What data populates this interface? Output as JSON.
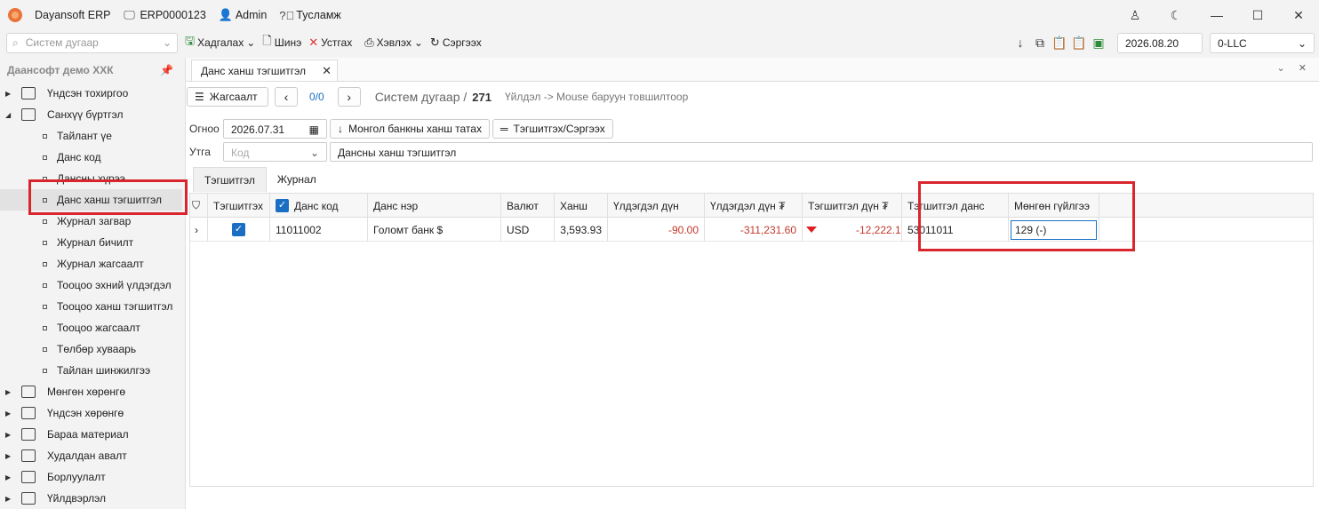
{
  "titlebar": {
    "app_name": "Dayansoft ERP",
    "erp_id": "ERP0000123",
    "user": "Admin",
    "help": "Тусламж"
  },
  "toolbar": {
    "search_placeholder": "Систем дугаар",
    "save": "Хадгалах",
    "new": "Шинэ",
    "delete": "Устгах",
    "print": "Хэвлэх",
    "refresh": "Сэргээх",
    "date": "2026.08.20",
    "company": "0-LLC"
  },
  "sidebar": {
    "header": "Даансофт демо ХХК",
    "items": [
      {
        "label": "Үндсэн тохиргоо",
        "level": 0
      },
      {
        "label": "Санхүү бүртгэл",
        "level": 0
      },
      {
        "label": "Тайлант үе",
        "level": 1
      },
      {
        "label": "Данс код",
        "level": 1
      },
      {
        "label": "Дансны хүрээ",
        "level": 1
      },
      {
        "label": "Данс ханш тэгшитгэл",
        "level": 1
      },
      {
        "label": "Журнал загвар",
        "level": 1
      },
      {
        "label": "Журнал бичилт",
        "level": 1
      },
      {
        "label": "Журнал жагсаалт",
        "level": 1
      },
      {
        "label": "Тооцоо эхний үлдэгдэл",
        "level": 1
      },
      {
        "label": "Тооцоо ханш тэгшитгэл",
        "level": 1
      },
      {
        "label": "Тооцоо жагсаалт",
        "level": 1
      },
      {
        "label": "Төлбөр хуваарь",
        "level": 1
      },
      {
        "label": "Тайлан шинжилгээ",
        "level": 1
      },
      {
        "label": "Мөнгөн хөрөнгө",
        "level": 0
      },
      {
        "label": "Үндсэн хөрөнгө",
        "level": 0
      },
      {
        "label": "Бараа материал",
        "level": 0
      },
      {
        "label": "Худалдан авалт",
        "level": 0
      },
      {
        "label": "Борлуулалт",
        "level": 0
      },
      {
        "label": "Үйлдвэрлэл",
        "level": 0
      }
    ]
  },
  "doc_tab": {
    "title": "Данс ханш тэгшитгэл"
  },
  "nav": {
    "list": "Жагсаалт",
    "count": "0/0",
    "sys_label": "Систем дугаар /",
    "sys_num": "271",
    "hint": "Үйлдэл -> Mouse баруун товшилтоор"
  },
  "form": {
    "date_label": "Огноо",
    "date_value": "2026.07.31",
    "fetch_btn": "Монгол банкны ханш татах",
    "recalc_btn": "Тэгшитгэх/Сэргээх",
    "utga_label": "Утга",
    "code_placeholder": "Код",
    "utga_value": "Дансны ханш тэгшитгэл"
  },
  "subtabs": [
    "Тэгшитгэл",
    "Журнал"
  ],
  "grid": {
    "headers": [
      "Тэгшитгэх",
      "Данс код",
      "Данс нэр",
      "Валют",
      "Ханш",
      "Үлдэгдэл дүн",
      "Үлдэгдэл дүн ₮",
      "Тэгшитгэл дүн ₮",
      "Тэгшитгэл данс",
      "Мөнгөн гүйлгээ"
    ],
    "rows": [
      {
        "code": "11011002",
        "name": "Голомт банк $",
        "currency": "USD",
        "rate": "3,593.93",
        "balance": "-90.00",
        "balance_mnt": "-311,231.60",
        "adjust_mnt": "-12,222.10",
        "adjust_acct": "53011011",
        "cash_flow": "129 (-)"
      }
    ]
  },
  "colors": {
    "accent": "#1a6fc4",
    "negative": "#c0392b",
    "highlight": "#d9262e"
  }
}
